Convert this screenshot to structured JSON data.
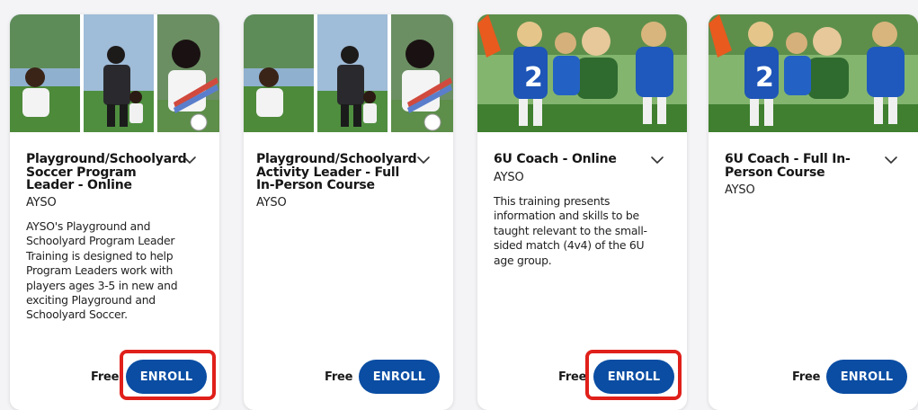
{
  "courses": [
    {
      "title": "Playground/Schoolyard Soccer Program Leader - Online",
      "provider": "AYSO",
      "description": "AYSO's Playground and Schoolyard Program Leader Training is designed to help Program Leaders work with players ages 3-5 in new and exciting Playground and Schoolyard Soccer.",
      "price": "Free",
      "enroll_label": "ENROLL",
      "image": "children-playing-soccer-photo",
      "highlighted": true
    },
    {
      "title": "Playground/Schoolyard Activity Leader - Full In-Person Course",
      "provider": "AYSO",
      "description": "",
      "price": "Free",
      "enroll_label": "ENROLL",
      "image": "children-playing-soccer-photo",
      "highlighted": false
    },
    {
      "title": "6U Coach - Online",
      "provider": "AYSO",
      "description": "This training presents information and skills to be taught relevant to the small-sided match (4v4) of the 6U age group.",
      "price": "Free",
      "enroll_label": "ENROLL",
      "image": "coach-with-girls-team-photo",
      "highlighted": true
    },
    {
      "title": "6U Coach - Full In-Person Course",
      "provider": "AYSO",
      "description": "",
      "price": "Free",
      "enroll_label": "ENROLL",
      "image": "coach-with-girls-team-photo",
      "highlighted": false
    }
  ],
  "colors": {
    "enroll_button": "#0a4da3",
    "highlight": "#e0201b",
    "card_bg": "#ffffff",
    "page_bg": "#f4f4f6"
  }
}
